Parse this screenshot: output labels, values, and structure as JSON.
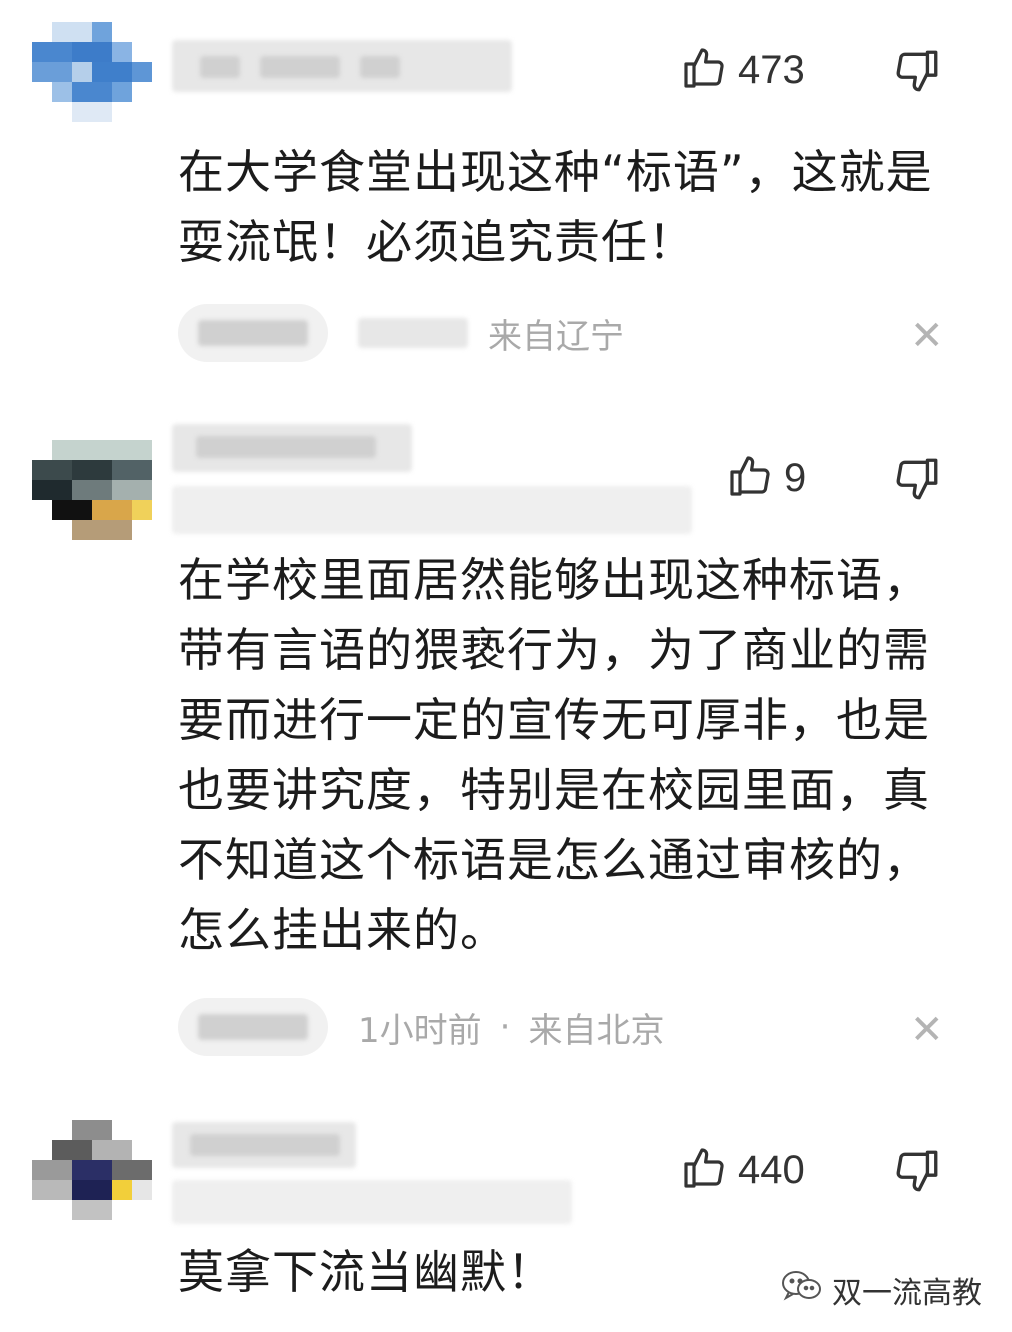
{
  "comments": [
    {
      "likes": "473",
      "text": "在大学食堂出现这种“标语”，这就是耍流氓！必须追究责任！",
      "location": "来自辽宁"
    },
    {
      "likes": "9",
      "text": "在学校里面居然能够出现这种标语，带有言语的猥亵行为，为了商业的需要而进行一定的宣传无可厚非，也是也要讲究度，特别是在校园里面，真不知道这个标语是怎么通过审核的，怎么挂出来的。",
      "time": "1小时前",
      "separator": "·",
      "location": "来自北京"
    },
    {
      "likes": "440",
      "text": "莫拿下流当幽默！"
    }
  ],
  "icons": {
    "like": "thumbs-up-icon",
    "dislike": "thumbs-down-icon",
    "close": "close-icon",
    "close_glyph": "✕",
    "watermark": "wechat-icon"
  },
  "watermark": {
    "label": "双一流高教"
  }
}
